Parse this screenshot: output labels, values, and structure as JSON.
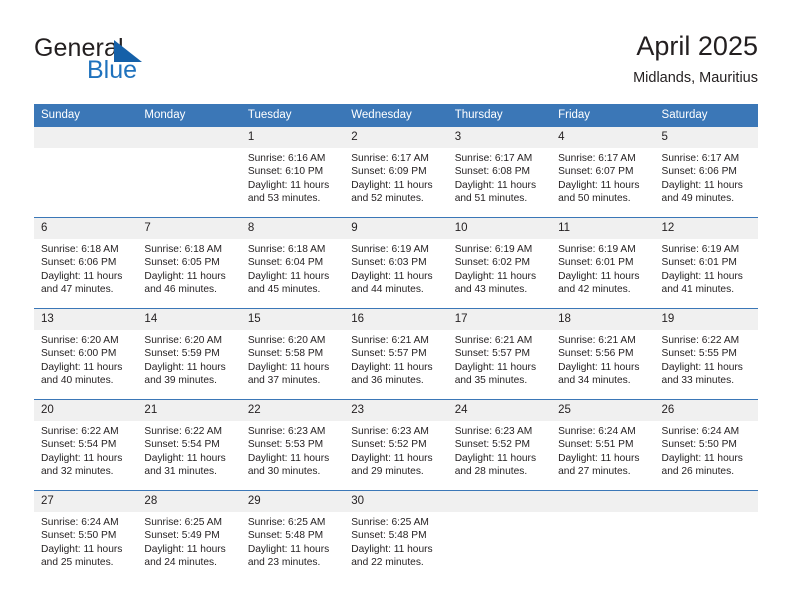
{
  "brand": {
    "name_top": "General",
    "name_bottom": "Blue",
    "triangle_icon": "blue-triangle-icon",
    "accent_color": "#1f72bd"
  },
  "header": {
    "title": "April 2025",
    "subtitle": "Midlands, Mauritius"
  },
  "theme": {
    "header_row_bg": "#3b77b7",
    "daynum_bg": "#f0f0f0",
    "row_divider": "#3b77b7",
    "text": "#231f20"
  },
  "calendar": {
    "weekday_headers": [
      "Sunday",
      "Monday",
      "Tuesday",
      "Wednesday",
      "Thursday",
      "Friday",
      "Saturday"
    ],
    "weeks": [
      [
        {
          "day": "",
          "sunrise": "",
          "sunset": "",
          "daylight_line1": "",
          "daylight_line2": ""
        },
        {
          "day": "",
          "sunrise": "",
          "sunset": "",
          "daylight_line1": "",
          "daylight_line2": ""
        },
        {
          "day": "1",
          "sunrise": "Sunrise: 6:16 AM",
          "sunset": "Sunset: 6:10 PM",
          "daylight_line1": "Daylight: 11 hours",
          "daylight_line2": "and 53 minutes."
        },
        {
          "day": "2",
          "sunrise": "Sunrise: 6:17 AM",
          "sunset": "Sunset: 6:09 PM",
          "daylight_line1": "Daylight: 11 hours",
          "daylight_line2": "and 52 minutes."
        },
        {
          "day": "3",
          "sunrise": "Sunrise: 6:17 AM",
          "sunset": "Sunset: 6:08 PM",
          "daylight_line1": "Daylight: 11 hours",
          "daylight_line2": "and 51 minutes."
        },
        {
          "day": "4",
          "sunrise": "Sunrise: 6:17 AM",
          "sunset": "Sunset: 6:07 PM",
          "daylight_line1": "Daylight: 11 hours",
          "daylight_line2": "and 50 minutes."
        },
        {
          "day": "5",
          "sunrise": "Sunrise: 6:17 AM",
          "sunset": "Sunset: 6:06 PM",
          "daylight_line1": "Daylight: 11 hours",
          "daylight_line2": "and 49 minutes."
        }
      ],
      [
        {
          "day": "6",
          "sunrise": "Sunrise: 6:18 AM",
          "sunset": "Sunset: 6:06 PM",
          "daylight_line1": "Daylight: 11 hours",
          "daylight_line2": "and 47 minutes."
        },
        {
          "day": "7",
          "sunrise": "Sunrise: 6:18 AM",
          "sunset": "Sunset: 6:05 PM",
          "daylight_line1": "Daylight: 11 hours",
          "daylight_line2": "and 46 minutes."
        },
        {
          "day": "8",
          "sunrise": "Sunrise: 6:18 AM",
          "sunset": "Sunset: 6:04 PM",
          "daylight_line1": "Daylight: 11 hours",
          "daylight_line2": "and 45 minutes."
        },
        {
          "day": "9",
          "sunrise": "Sunrise: 6:19 AM",
          "sunset": "Sunset: 6:03 PM",
          "daylight_line1": "Daylight: 11 hours",
          "daylight_line2": "and 44 minutes."
        },
        {
          "day": "10",
          "sunrise": "Sunrise: 6:19 AM",
          "sunset": "Sunset: 6:02 PM",
          "daylight_line1": "Daylight: 11 hours",
          "daylight_line2": "and 43 minutes."
        },
        {
          "day": "11",
          "sunrise": "Sunrise: 6:19 AM",
          "sunset": "Sunset: 6:01 PM",
          "daylight_line1": "Daylight: 11 hours",
          "daylight_line2": "and 42 minutes."
        },
        {
          "day": "12",
          "sunrise": "Sunrise: 6:19 AM",
          "sunset": "Sunset: 6:01 PM",
          "daylight_line1": "Daylight: 11 hours",
          "daylight_line2": "and 41 minutes."
        }
      ],
      [
        {
          "day": "13",
          "sunrise": "Sunrise: 6:20 AM",
          "sunset": "Sunset: 6:00 PM",
          "daylight_line1": "Daylight: 11 hours",
          "daylight_line2": "and 40 minutes."
        },
        {
          "day": "14",
          "sunrise": "Sunrise: 6:20 AM",
          "sunset": "Sunset: 5:59 PM",
          "daylight_line1": "Daylight: 11 hours",
          "daylight_line2": "and 39 minutes."
        },
        {
          "day": "15",
          "sunrise": "Sunrise: 6:20 AM",
          "sunset": "Sunset: 5:58 PM",
          "daylight_line1": "Daylight: 11 hours",
          "daylight_line2": "and 37 minutes."
        },
        {
          "day": "16",
          "sunrise": "Sunrise: 6:21 AM",
          "sunset": "Sunset: 5:57 PM",
          "daylight_line1": "Daylight: 11 hours",
          "daylight_line2": "and 36 minutes."
        },
        {
          "day": "17",
          "sunrise": "Sunrise: 6:21 AM",
          "sunset": "Sunset: 5:57 PM",
          "daylight_line1": "Daylight: 11 hours",
          "daylight_line2": "and 35 minutes."
        },
        {
          "day": "18",
          "sunrise": "Sunrise: 6:21 AM",
          "sunset": "Sunset: 5:56 PM",
          "daylight_line1": "Daylight: 11 hours",
          "daylight_line2": "and 34 minutes."
        },
        {
          "day": "19",
          "sunrise": "Sunrise: 6:22 AM",
          "sunset": "Sunset: 5:55 PM",
          "daylight_line1": "Daylight: 11 hours",
          "daylight_line2": "and 33 minutes."
        }
      ],
      [
        {
          "day": "20",
          "sunrise": "Sunrise: 6:22 AM",
          "sunset": "Sunset: 5:54 PM",
          "daylight_line1": "Daylight: 11 hours",
          "daylight_line2": "and 32 minutes."
        },
        {
          "day": "21",
          "sunrise": "Sunrise: 6:22 AM",
          "sunset": "Sunset: 5:54 PM",
          "daylight_line1": "Daylight: 11 hours",
          "daylight_line2": "and 31 minutes."
        },
        {
          "day": "22",
          "sunrise": "Sunrise: 6:23 AM",
          "sunset": "Sunset: 5:53 PM",
          "daylight_line1": "Daylight: 11 hours",
          "daylight_line2": "and 30 minutes."
        },
        {
          "day": "23",
          "sunrise": "Sunrise: 6:23 AM",
          "sunset": "Sunset: 5:52 PM",
          "daylight_line1": "Daylight: 11 hours",
          "daylight_line2": "and 29 minutes."
        },
        {
          "day": "24",
          "sunrise": "Sunrise: 6:23 AM",
          "sunset": "Sunset: 5:52 PM",
          "daylight_line1": "Daylight: 11 hours",
          "daylight_line2": "and 28 minutes."
        },
        {
          "day": "25",
          "sunrise": "Sunrise: 6:24 AM",
          "sunset": "Sunset: 5:51 PM",
          "daylight_line1": "Daylight: 11 hours",
          "daylight_line2": "and 27 minutes."
        },
        {
          "day": "26",
          "sunrise": "Sunrise: 6:24 AM",
          "sunset": "Sunset: 5:50 PM",
          "daylight_line1": "Daylight: 11 hours",
          "daylight_line2": "and 26 minutes."
        }
      ],
      [
        {
          "day": "27",
          "sunrise": "Sunrise: 6:24 AM",
          "sunset": "Sunset: 5:50 PM",
          "daylight_line1": "Daylight: 11 hours",
          "daylight_line2": "and 25 minutes."
        },
        {
          "day": "28",
          "sunrise": "Sunrise: 6:25 AM",
          "sunset": "Sunset: 5:49 PM",
          "daylight_line1": "Daylight: 11 hours",
          "daylight_line2": "and 24 minutes."
        },
        {
          "day": "29",
          "sunrise": "Sunrise: 6:25 AM",
          "sunset": "Sunset: 5:48 PM",
          "daylight_line1": "Daylight: 11 hours",
          "daylight_line2": "and 23 minutes."
        },
        {
          "day": "30",
          "sunrise": "Sunrise: 6:25 AM",
          "sunset": "Sunset: 5:48 PM",
          "daylight_line1": "Daylight: 11 hours",
          "daylight_line2": "and 22 minutes."
        },
        {
          "day": "",
          "sunrise": "",
          "sunset": "",
          "daylight_line1": "",
          "daylight_line2": ""
        },
        {
          "day": "",
          "sunrise": "",
          "sunset": "",
          "daylight_line1": "",
          "daylight_line2": ""
        },
        {
          "day": "",
          "sunrise": "",
          "sunset": "",
          "daylight_line1": "",
          "daylight_line2": ""
        }
      ]
    ]
  }
}
